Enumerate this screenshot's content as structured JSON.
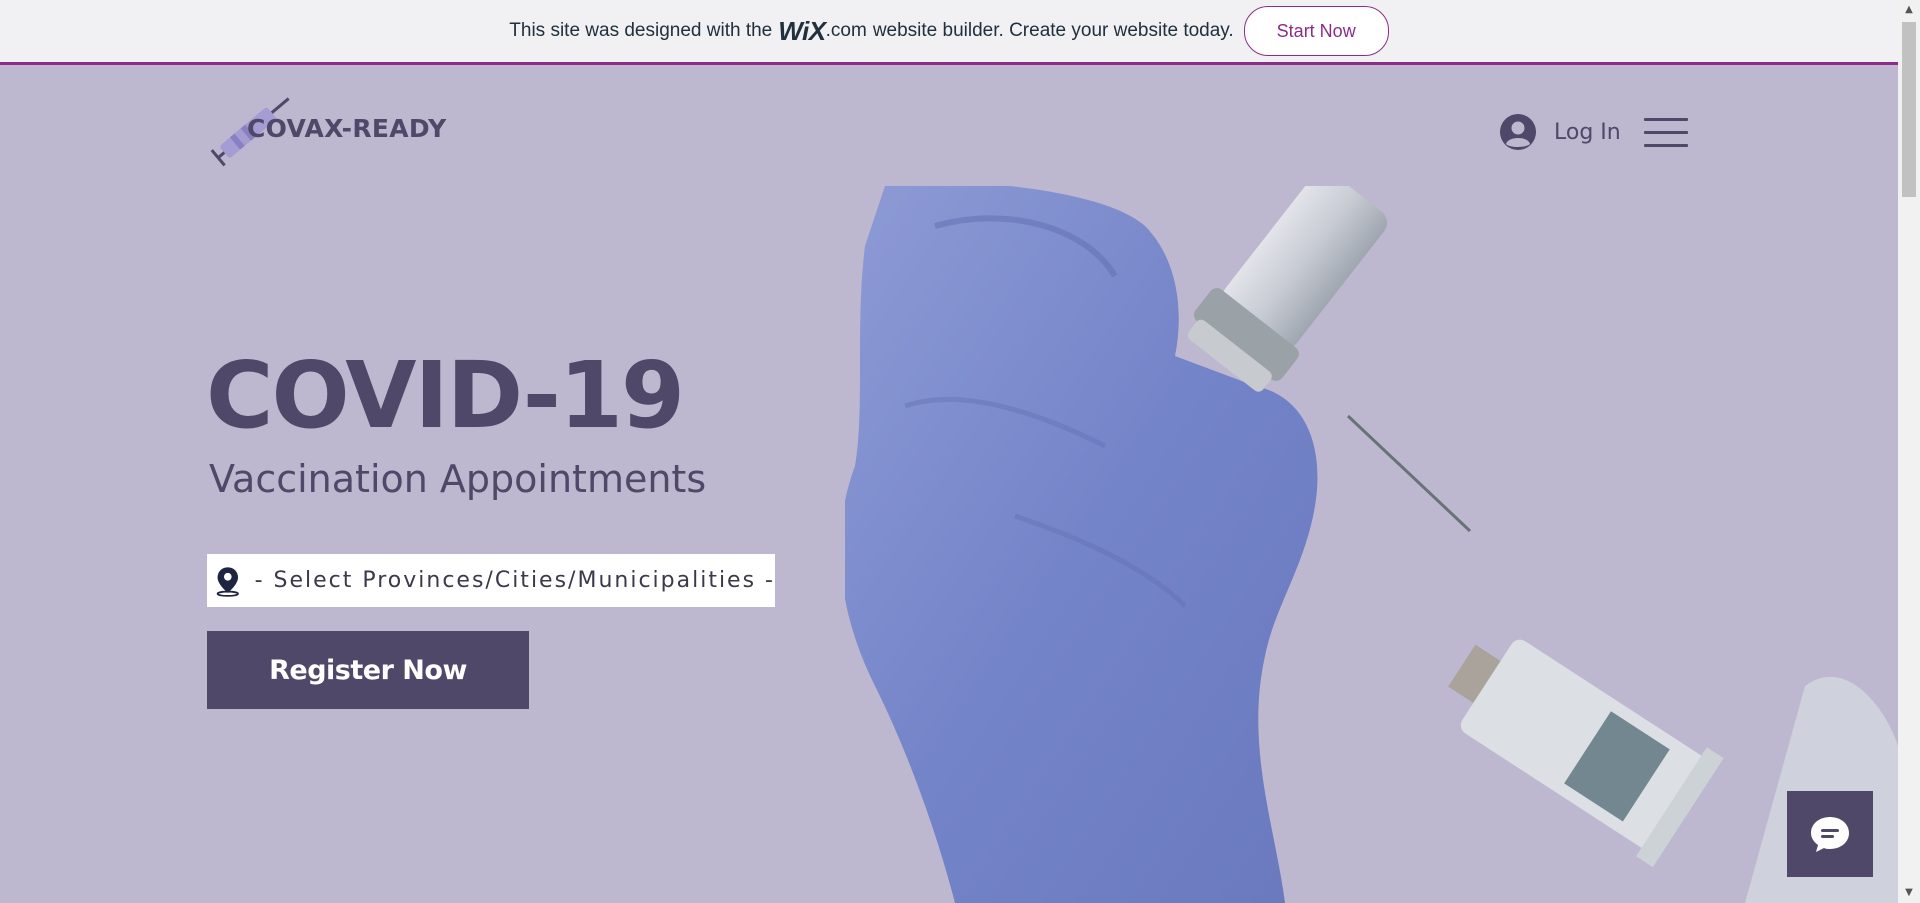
{
  "banner": {
    "text_before": "This site was designed with the",
    "wix_logo": "WiX",
    "text_after_logo": ".com",
    "text_after": "website builder. Create your website today.",
    "cta_label": "Start Now"
  },
  "header": {
    "logo_text": "COVAX-READY",
    "login_label": "Log In",
    "icons": {
      "login": "user-avatar-icon",
      "menu": "hamburger-menu-icon",
      "logo": "syringe-icon"
    }
  },
  "hero": {
    "title": "COVID-19",
    "subtitle": "Vaccination Appointments",
    "location_placeholder": "- Select Provinces/Cities/Municipalities -",
    "location_icon": "location-pin-icon",
    "register_label": "Register Now"
  },
  "chat": {
    "icon": "chat-bubble-icon"
  },
  "colors": {
    "background": "#bdb8cf",
    "primary": "#4f4869",
    "wix_accent": "#8b2c88",
    "banner_bg": "#f1f1f4"
  }
}
